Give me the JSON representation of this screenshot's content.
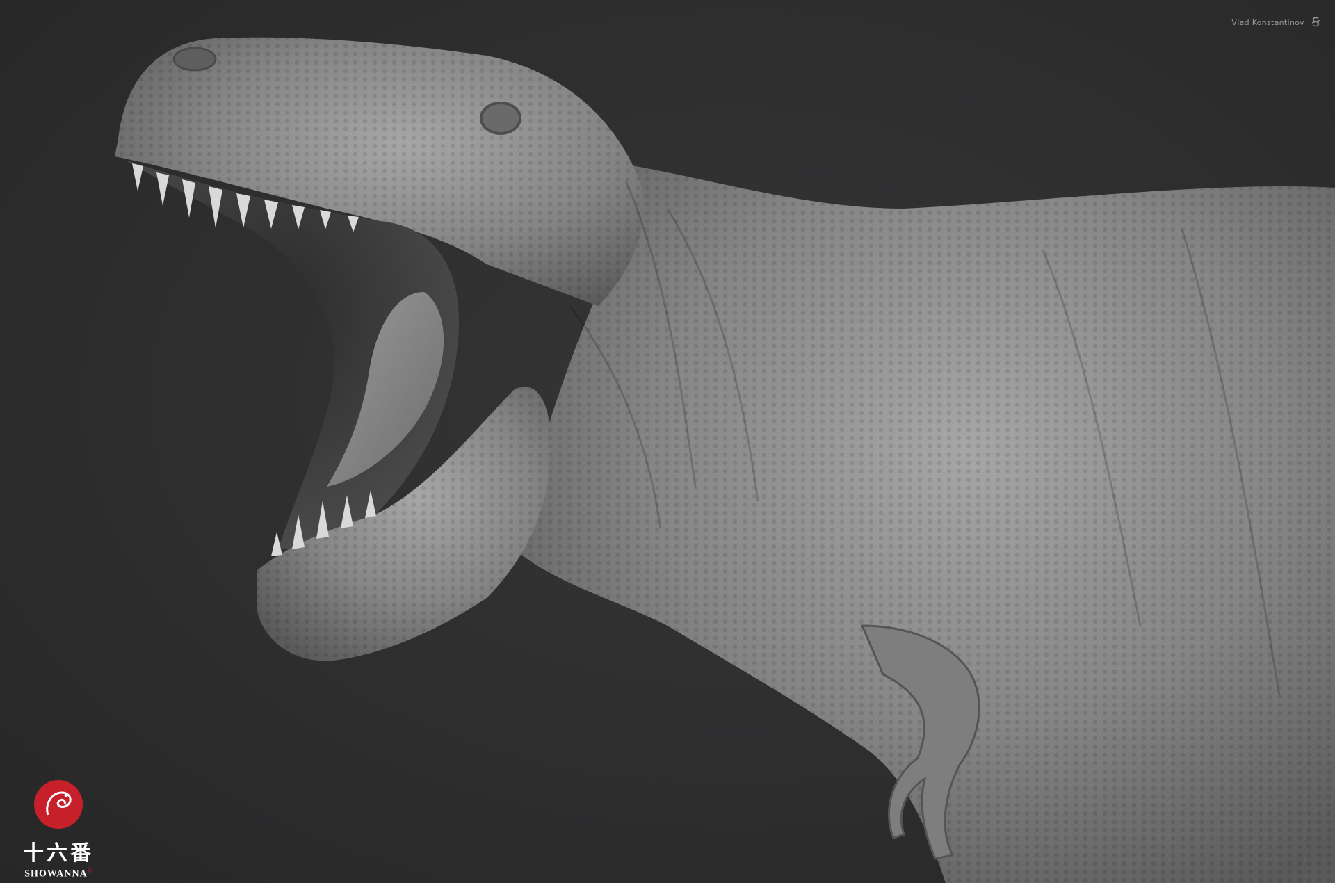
{
  "artist": {
    "name": "Vlad Konstantinov",
    "signature_glyph": "Ꞩ"
  },
  "logo": {
    "chinese": "十六番",
    "english": "SHOWANNA",
    "mark": "®"
  },
  "colors": {
    "background": "#2f2f30",
    "skin": "#8c8c8c",
    "seal": "#c8202a"
  }
}
